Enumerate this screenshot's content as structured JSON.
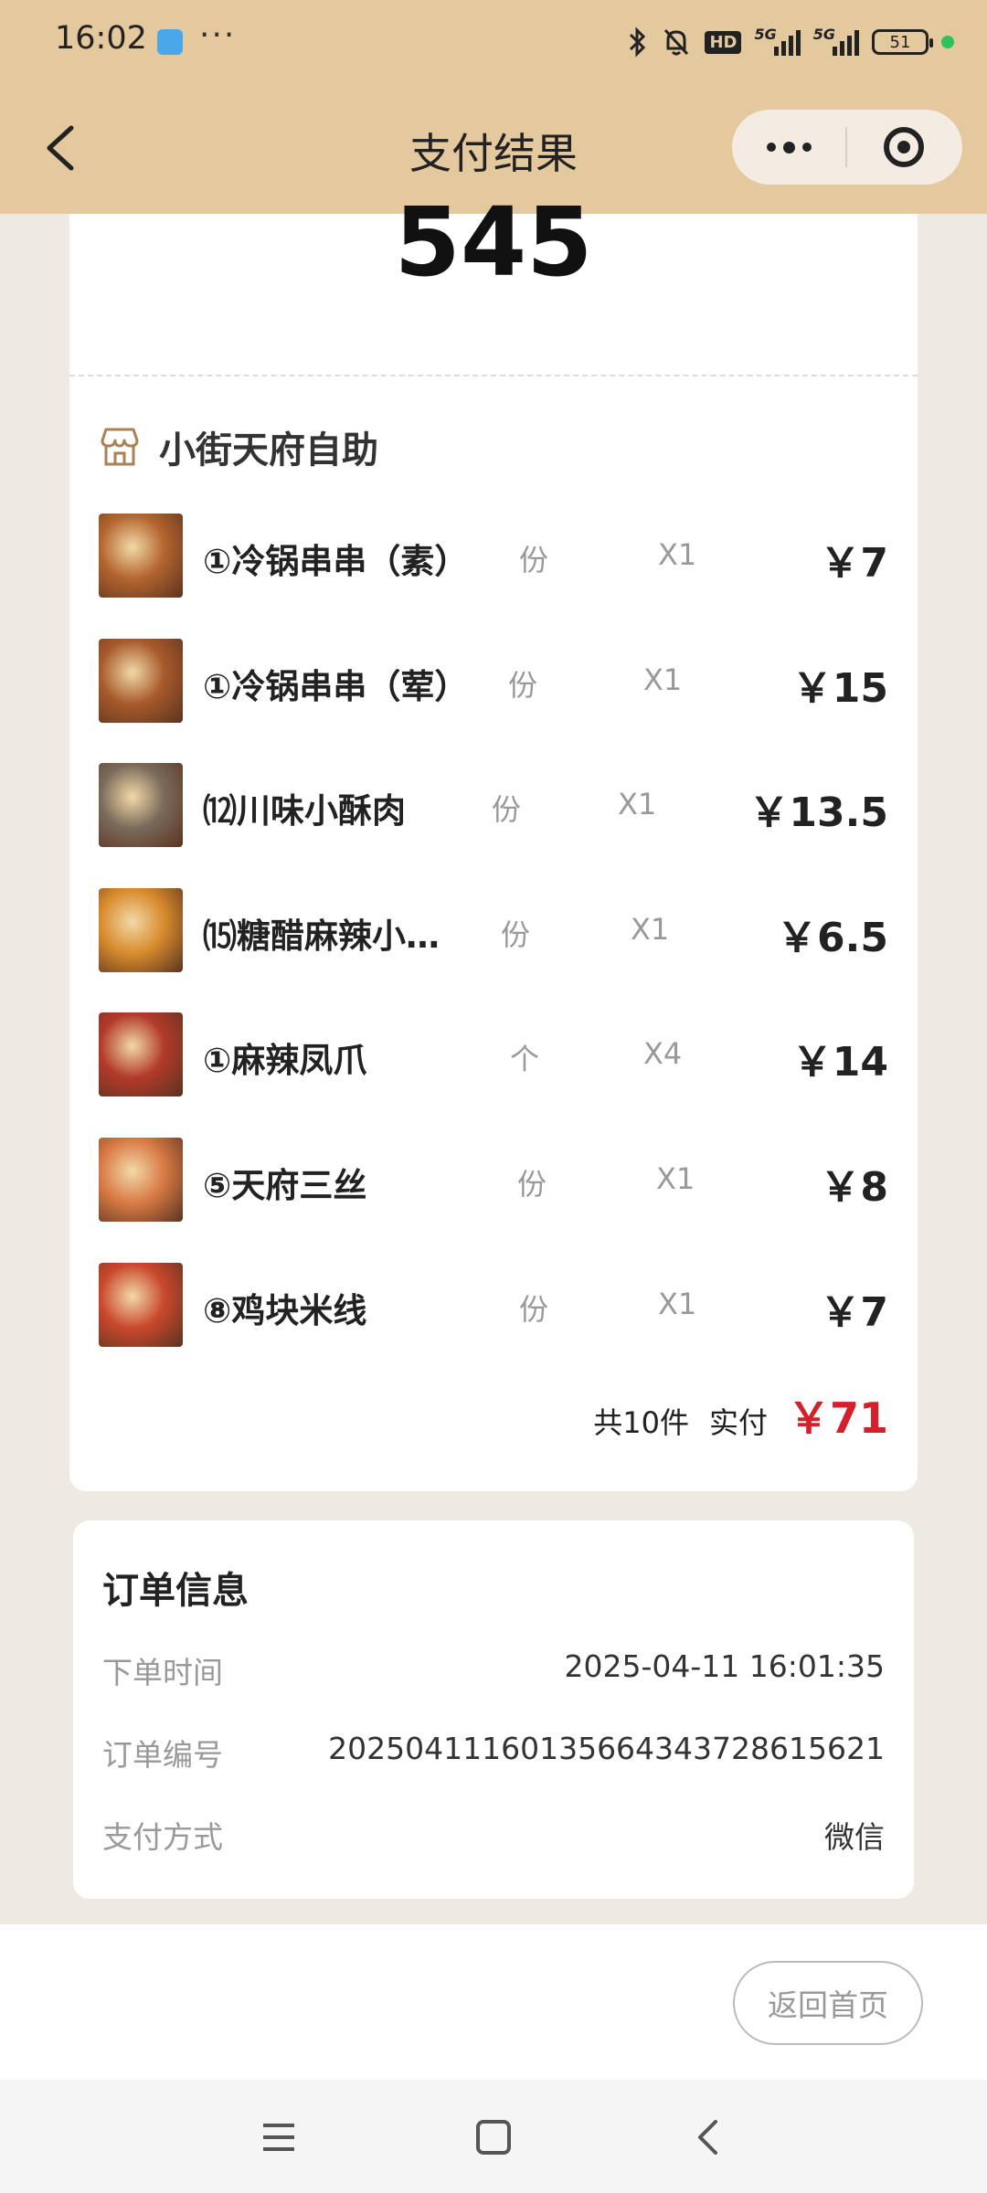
{
  "status_bar": {
    "time": "16:02",
    "dots": "···",
    "signal_label_1": "5G",
    "signal_label_2": "5G",
    "hd_label": "HD",
    "battery": "51"
  },
  "nav": {
    "title": "支付结果"
  },
  "order": {
    "pickup_number": "545",
    "store_name": "小街天府自助",
    "items": [
      {
        "name": "①冷锅串串（素）",
        "unit": "份",
        "qty": "X1",
        "price": "￥7",
        "thumb_color": "#b4652e"
      },
      {
        "name": "①冷锅串串（荤）",
        "unit": "份",
        "qty": "X1",
        "price": "￥15",
        "thumb_color": "#a85a2b"
      },
      {
        "name": "⑿川味小酥肉",
        "unit": "份",
        "qty": "X1",
        "price": "￥13.5",
        "thumb_color": "#7a6a5a"
      },
      {
        "name": "⒂糖醋麻辣小…",
        "unit": "份",
        "qty": "X1",
        "price": "￥6.5",
        "thumb_color": "#d88b2c"
      },
      {
        "name": "①麻辣凤爪",
        "unit": "个",
        "qty": "X4",
        "price": "￥14",
        "thumb_color": "#b33a2a"
      },
      {
        "name": "⑤天府三丝",
        "unit": "份",
        "qty": "X1",
        "price": "￥8",
        "thumb_color": "#d97a45"
      },
      {
        "name": "⑧鸡块米线",
        "unit": "份",
        "qty": "X1",
        "price": "￥7",
        "thumb_color": "#c9482c"
      }
    ],
    "total_count": "共10件",
    "paid_label": "实付",
    "paid_amount": "￥71"
  },
  "info": {
    "title": "订单信息",
    "rows": [
      {
        "label": "下单时间",
        "value": "2025-04-11 16:01:35"
      },
      {
        "label": "订单编号",
        "value": "2025041116013566434372861562​1"
      },
      {
        "label": "支付方式",
        "value": "微信"
      }
    ]
  },
  "actions": {
    "home_button": "返回首页"
  },
  "colors": {
    "header_bg": "#e4c89e",
    "accent_red": "#d4202a",
    "page_bg": "#eee9e3"
  }
}
